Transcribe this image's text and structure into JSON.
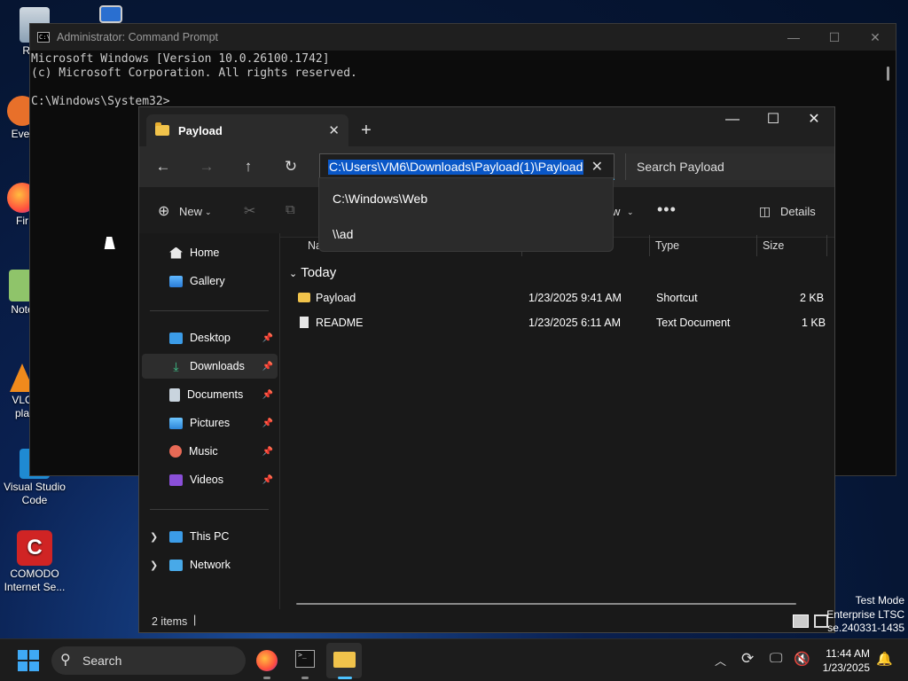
{
  "desktop": {
    "icons": [
      {
        "label": "Recy",
        "icon": "recycle-bin-icon"
      },
      {
        "label": "",
        "icon": "this-pc-icon"
      },
      {
        "label": "Ever",
        "icon": "everything-icon"
      },
      {
        "label": "Fir",
        "icon": "firefox-icon"
      },
      {
        "label": "Note",
        "icon": "notepad-icon"
      },
      {
        "label": "VLC",
        "label2": "pla",
        "icon": "vlc-icon"
      },
      {
        "label": "Visual Studio",
        "label2": "Code",
        "icon": "vscode-icon"
      },
      {
        "label": "COMODO",
        "label2": "Internet Se...",
        "icon": "comodo-icon"
      }
    ],
    "watermark": [
      "Test Mode",
      "Enterprise LTSC",
      "se.240331-1435"
    ]
  },
  "cmd": {
    "title": "Administrator: Command Prompt",
    "lines": [
      "Microsoft Windows [Version 10.0.26100.1742]",
      "(c) Microsoft Corporation. All rights reserved.",
      "",
      "C:\\Windows\\System32>"
    ]
  },
  "explorer": {
    "tab_title": "Payload",
    "address": "C:\\Users\\VM6\\Downloads\\Payload(1)\\Payload",
    "search_placeholder": "Search Payload",
    "suggestions": [
      "C:\\Windows\\Web",
      "\\\\ad"
    ],
    "toolbar": {
      "new_label": "New",
      "view_label": "w",
      "details_label": "Details"
    },
    "nav": {
      "home": "Home",
      "gallery": "Gallery",
      "desktop": "Desktop",
      "downloads": "Downloads",
      "documents": "Documents",
      "pictures": "Pictures",
      "music": "Music",
      "videos": "Videos",
      "this_pc": "This PC",
      "network": "Network"
    },
    "columns": {
      "name": "Na",
      "type": "Type",
      "size": "Size"
    },
    "group": "Today",
    "files": [
      {
        "name": "Payload",
        "date": "1/23/2025 9:41 AM",
        "type": "Shortcut",
        "size": "2 KB"
      },
      {
        "name": "README",
        "date": "1/23/2025 6:11 AM",
        "type": "Text Document",
        "size": "1 KB"
      }
    ],
    "status": "2 items"
  },
  "taskbar": {
    "search": "Search",
    "time": "11:44 AM",
    "date": "1/23/2025"
  },
  "colors": {
    "accent": "#4cc2ff",
    "selection": "#0a57c7",
    "folder": "#f1c34b"
  }
}
